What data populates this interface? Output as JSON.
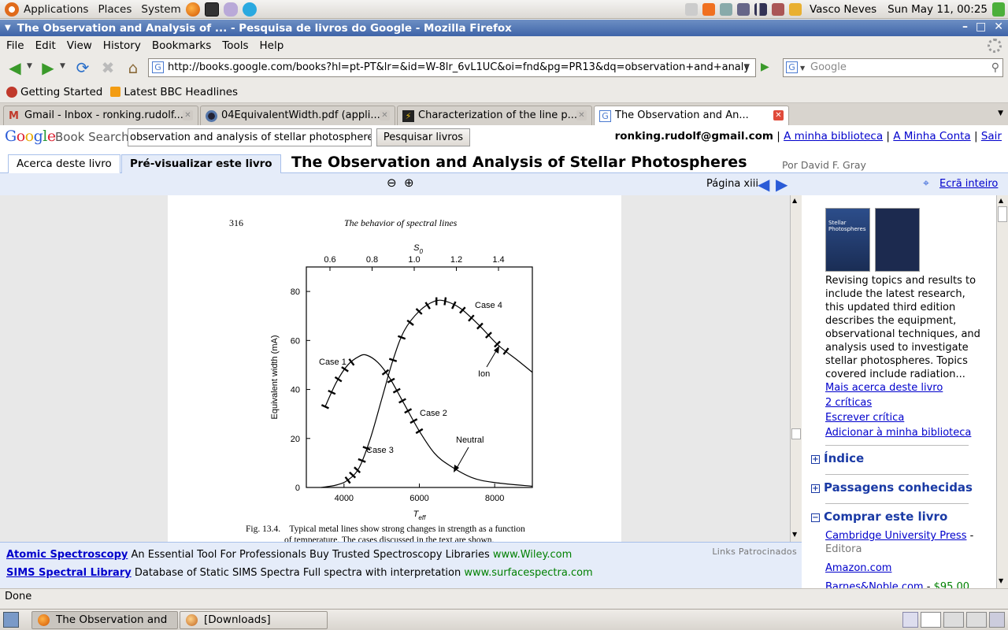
{
  "panel": {
    "menus": [
      "Applications",
      "Places",
      "System"
    ],
    "user": "Vasco Neves",
    "clock": "Sun May 11, 00:25"
  },
  "window": {
    "title": "The Observation and Analysis of ... - Pesquisa de livros do Google - Mozilla Firefox"
  },
  "menubar": [
    "File",
    "Edit",
    "View",
    "History",
    "Bookmarks",
    "Tools",
    "Help"
  ],
  "navbar": {
    "url": "http://books.google.com/books?hl=pt-PT&lr=&id=W-8lr_6vL1UC&oi=fnd&pg=PR13&dq=observation+and+analy",
    "search_placeholder": "Google"
  },
  "bookmarks": [
    "Getting Started",
    "Latest BBC Headlines"
  ],
  "tabs": [
    {
      "label": "Gmail - Inbox - ronking.rudolf..."
    },
    {
      "label": "04EquivalentWidth.pdf (appli..."
    },
    {
      "label": "Characterization of the line p..."
    },
    {
      "label": "The Observation and An..."
    }
  ],
  "gbs": {
    "logo": "Google",
    "product": "Book Search",
    "query": "observation and analysis of stellar photospheres",
    "search_button": "Pesquisar livros",
    "account_email": "ronking.rudolf@gmail.com",
    "links": [
      "A minha biblioteca",
      "A Minha Conta",
      "Sair"
    ],
    "tab_about": "Acerca deste livro",
    "tab_preview": "Pré-visualizar este livro",
    "book_title": "The Observation and Analysis of Stellar Photospheres",
    "author": "Por David F. Gray",
    "page_label": "Página xiii",
    "fullscreen": "Ecrã inteiro"
  },
  "book_page": {
    "page_number": "316",
    "running_head": "The behavior of spectral lines",
    "caption_line1": "Fig. 13.4.    Typical metal lines show strong changes in strength as a function",
    "caption_line2": "of temperature. The cases discussed in the text are shown."
  },
  "chart_data": {
    "type": "line",
    "xlabel": "T",
    "xlabel_sub": "eff",
    "ylabel": "Equivalent width (mA)",
    "top_axis_label": "S",
    "top_axis_sub": "0",
    "xticks": [
      "4000",
      "6000",
      "8000"
    ],
    "yticks": [
      "0",
      "20",
      "40",
      "60",
      "80"
    ],
    "top_ticks": [
      "0.6",
      "0.8",
      "1.0",
      "1.2",
      "1.4"
    ],
    "xlim": [
      3000,
      9000
    ],
    "ylim": [
      0,
      90
    ],
    "series": [
      {
        "name": "Neutral",
        "points": [
          [
            3500,
            33
          ],
          [
            3800,
            43
          ],
          [
            4100,
            50
          ],
          [
            4400,
            53.5
          ],
          [
            4600,
            54
          ],
          [
            4900,
            51
          ],
          [
            5200,
            45
          ],
          [
            5600,
            34
          ],
          [
            6000,
            23
          ],
          [
            6400,
            14
          ],
          [
            6800,
            9
          ],
          [
            7400,
            4
          ],
          [
            8000,
            2
          ],
          [
            9000,
            0.5
          ]
        ]
      },
      {
        "name": "Ion",
        "points": [
          [
            3400,
            0
          ],
          [
            3800,
            1
          ],
          [
            4100,
            3
          ],
          [
            4400,
            8
          ],
          [
            4700,
            20
          ],
          [
            5000,
            36
          ],
          [
            5300,
            52
          ],
          [
            5600,
            64
          ],
          [
            6000,
            72
          ],
          [
            6400,
            76
          ],
          [
            6700,
            76
          ],
          [
            7100,
            73
          ],
          [
            7600,
            66
          ],
          [
            8100,
            58
          ],
          [
            8600,
            52
          ],
          [
            9000,
            47
          ]
        ]
      }
    ],
    "annotations": [
      "Case 1",
      "Case 2",
      "Case 3",
      "Case 4",
      "Neutral",
      "Ion"
    ]
  },
  "sidebar": {
    "description": "Revising topics and results to include the latest research, this updated third edition describes the equipment, observational techniques, and analysis used to investigate stellar photospheres. Topics covered include radiation...",
    "links": [
      "Mais acerca deste livro",
      "2 críticas",
      "Escrever crítica",
      "Adicionar à minha biblioteca"
    ],
    "sections": [
      "Índice",
      "Passagens conhecidas",
      "Comprar este livro"
    ],
    "shops": [
      {
        "name": "Cambridge University Press",
        "suffix": " -",
        "sub": "Editora"
      },
      {
        "name": "Amazon.com",
        "suffix": "",
        "sub": ""
      },
      {
        "name": "Barnes&Noble.com",
        "suffix": " - ",
        "price": "$95,00"
      }
    ],
    "cover_title": "Stellar Photospheres"
  },
  "ads": {
    "sponsored_label": "Links Patrocinados",
    "items": [
      {
        "title": "Atomic Spectroscopy",
        "text": "An Essential Tool For Professionals Buy Trusted Spectroscopy Libraries",
        "url": "www.Wiley.com"
      },
      {
        "title": "SIMS Spectral Library",
        "text": "Database of Static SIMS Spectra Full spectra with interpretation",
        "url": "www.surfacespectra.com"
      }
    ]
  },
  "status": "Done",
  "taskbar": [
    {
      "label": "The Observation and ..."
    },
    {
      "label": "[Downloads]"
    }
  ]
}
